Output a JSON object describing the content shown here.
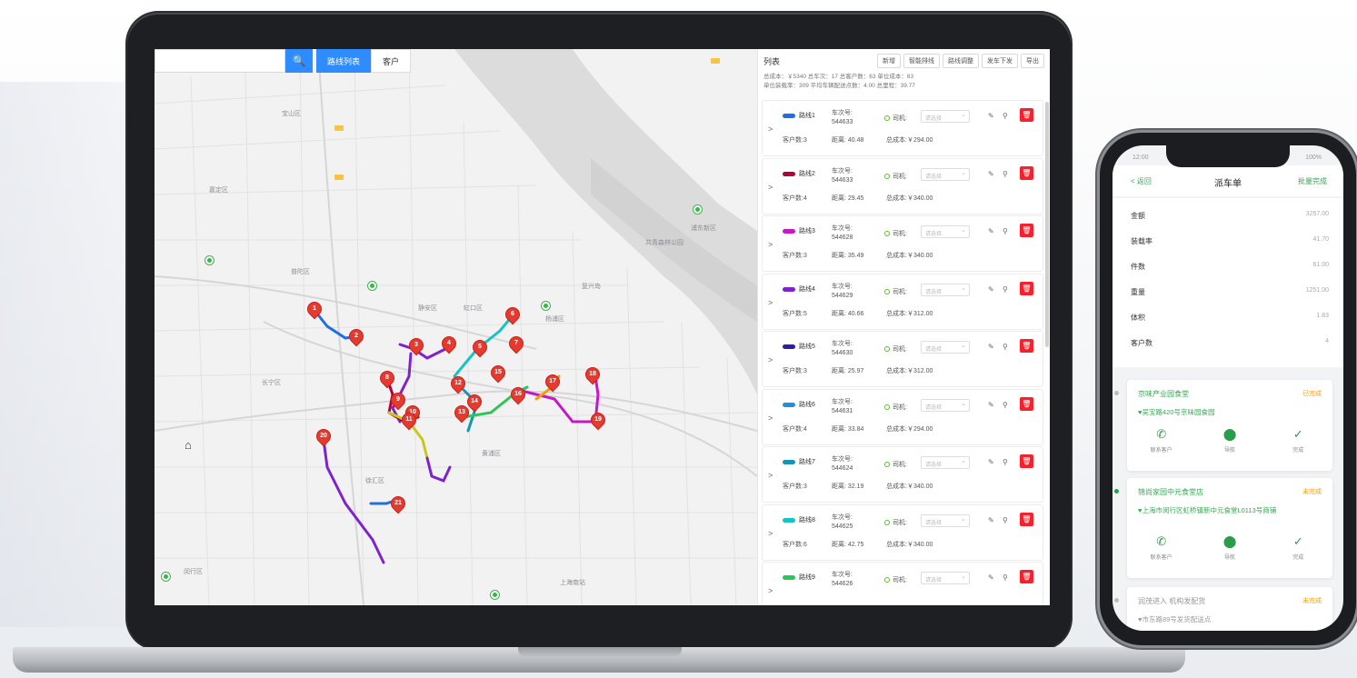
{
  "map": {
    "search_icon": "🔍",
    "tool_buttons": [
      "路线列表",
      "客户"
    ],
    "labels": [
      "宝山区",
      "浦东新区",
      "闵行区",
      "徐汇区",
      "长宁区",
      "普陀区",
      "嘉定区",
      "杨浦区",
      "虹口区",
      "静安区",
      "黄浦区",
      "共青森林公园",
      "复兴岛",
      "上海南站"
    ],
    "pins": [
      "1",
      "2",
      "3",
      "4",
      "5",
      "6",
      "7",
      "8",
      "9",
      "10",
      "11",
      "12",
      "13",
      "14",
      "15",
      "16",
      "17",
      "18",
      "19",
      "20",
      "21"
    ]
  },
  "panel": {
    "title": "列表",
    "buttons": [
      "新增",
      "智能排线",
      "路线调整",
      "发车下发",
      "导出"
    ],
    "summary_line1": "总成本：￥5340 总车次：17 总客户数：63 单位成本：83",
    "summary_line2": "单位装载率：309 平均车辆配送点数：4.00 总里程：39.77",
    "routes": [
      {
        "name": "路线1",
        "car_label": "车次号:",
        "car_no": "544633",
        "driver": "司机:",
        "select": "请选择",
        "clients": "客户数:3",
        "dist": "距离: 40.48",
        "cost": "总成本:￥294.00",
        "color": "#1f6fe0"
      },
      {
        "name": "路线2",
        "car_label": "车次号:",
        "car_no": "544633",
        "driver": "司机:",
        "select": "请选择",
        "clients": "客户数:4",
        "dist": "距离: 29.45",
        "cost": "总成本:￥340.00",
        "color": "#b3003b"
      },
      {
        "name": "路线3",
        "car_label": "车次号:",
        "car_no": "544628",
        "driver": "司机:",
        "select": "请选择",
        "clients": "客户数:3",
        "dist": "距离: 35.49",
        "cost": "总成本:￥340.00",
        "color": "#c418c9"
      },
      {
        "name": "路线4",
        "car_label": "车次号:",
        "car_no": "544629",
        "driver": "司机:",
        "select": "请选择",
        "clients": "客户数:5",
        "dist": "距离: 40.66",
        "cost": "总成本:￥312.00",
        "color": "#7e22ce"
      },
      {
        "name": "路线5",
        "car_label": "车次号:",
        "car_no": "544630",
        "driver": "司机:",
        "select": "请选择",
        "clients": "客户数:3",
        "dist": "距离: 25.97",
        "cost": "总成本:￥312.00",
        "color": "#2a1fa8"
      },
      {
        "name": "路线6",
        "car_label": "车次号:",
        "car_no": "544631",
        "driver": "司机:",
        "select": "请选择",
        "clients": "客户数:4",
        "dist": "距离: 33.84",
        "cost": "总成本:￥294.00",
        "color": "#1f8fe0"
      },
      {
        "name": "路线7",
        "car_label": "车次号:",
        "car_no": "544624",
        "driver": "司机:",
        "select": "请选择",
        "clients": "客户数:3",
        "dist": "距离: 32.19",
        "cost": "总成本:￥340.00",
        "color": "#1693b5"
      },
      {
        "name": "路线8",
        "car_label": "车次号:",
        "car_no": "544625",
        "driver": "司机:",
        "select": "请选择",
        "clients": "客户数:6",
        "dist": "距离: 42.75",
        "cost": "总成本:￥340.00",
        "color": "#17c3c3"
      },
      {
        "name": "路线9",
        "car_label": "车次号:",
        "car_no": "544626",
        "driver": "司机:",
        "select": "请选择",
        "clients": "",
        "dist": "",
        "cost": "",
        "color": "#2ec45a"
      }
    ]
  },
  "phone": {
    "status_left": "12:00",
    "status_right": "100%",
    "back": "< 返回",
    "title": "派车单",
    "action": "批量完成",
    "stats": [
      {
        "label": "金额",
        "value": "3257.00"
      },
      {
        "label": "装载率",
        "value": "41.70"
      },
      {
        "label": "件数",
        "value": "61.00"
      },
      {
        "label": "重量",
        "value": "1251.00"
      },
      {
        "label": "体积",
        "value": "1.83"
      },
      {
        "label": "客户数",
        "value": "4"
      }
    ],
    "cards": [
      {
        "name": "京味产业园食堂",
        "status": "已完成",
        "addr": "♥吴宝路420号京味园食园",
        "actions": [
          "联系客户",
          "导航",
          "完成"
        ]
      },
      {
        "name": "锦尚家园中元食堂店",
        "status": "未完成",
        "addr": "♥上海市闵行区虹桥镇新中元食堂L0113号商铺",
        "actions": [
          "联系客户",
          "导航",
          "完成"
        ]
      },
      {
        "name": "润茂进入 机构发配货",
        "status": "未完成",
        "addr": "♥市东路89号发货配送点",
        "actions": []
      }
    ]
  }
}
